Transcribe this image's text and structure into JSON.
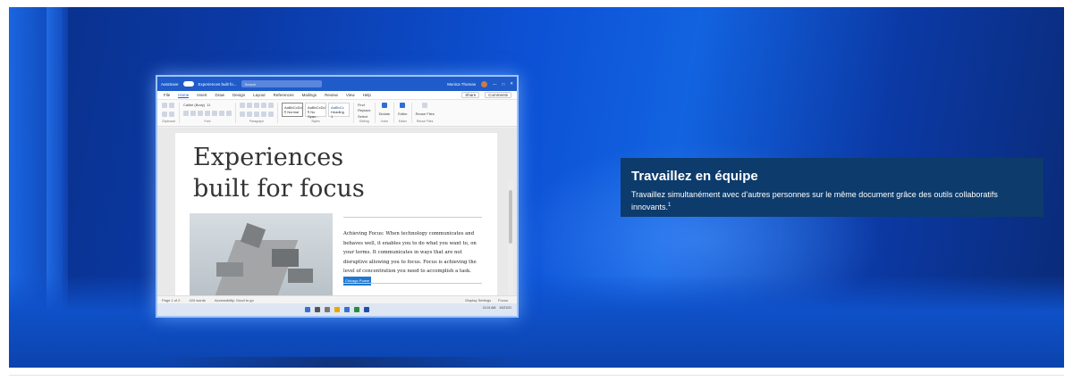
{
  "banner": {
    "colors": {
      "deep_blue": "#0a2f88",
      "bright_blue": "#1263e0",
      "card_bg": "#0d3b6b"
    }
  },
  "word_window": {
    "titlebar": {
      "autosave": "AutoSave",
      "file_name": "Experiences built fo...",
      "search_placeholder": "Search",
      "user_name": "Monica Thomas"
    },
    "menu": [
      "File",
      "Home",
      "Insert",
      "Draw",
      "Design",
      "Layout",
      "References",
      "Mailings",
      "Review",
      "View",
      "Help"
    ],
    "menu_active": "Home",
    "share_label": "Share",
    "comments_label": "Comments",
    "ribbon": {
      "groups": [
        "Clipboard",
        "Font",
        "Paragraph",
        "Styles",
        "Editing",
        "Voice",
        "Editor",
        "Reuse Files"
      ],
      "font_name": "Calibri (Body)",
      "font_size": "11",
      "styles": [
        "AaBbCcDd",
        "AaBbCcDd",
        "AaBbCc"
      ],
      "style_names": [
        "¶ Normal",
        "¶ No Spac...",
        "Heading 1"
      ],
      "editing": [
        "Find",
        "Replace",
        "Select"
      ],
      "voice": "Dictate",
      "editor": "Editor",
      "reuse": "Reuse Files"
    },
    "document": {
      "title_line1": "Experiences",
      "title_line2": "built for focus",
      "paragraph": "Achieving Focus: When technology communicates and behaves well, it enables you to do what you want to, on your terms. It communicates in ways that are not disruptive allowing you to focus. Focus is achieving the level of concentration you need to accomplish a task.",
      "coauthor_tag": "Chicago Pcane"
    },
    "statusbar": {
      "page": "Page 1 of 2",
      "words": "424 words",
      "accessibility": "Accessibility: Good to go",
      "display": "Display Settings",
      "focus": "Focus"
    },
    "taskbar": {
      "time": "11:01 AM",
      "date": "10/21/21"
    }
  },
  "info_card": {
    "title": "Travaillez en équipe",
    "text": "Travaillez simultanément avec d’autres personnes sur le même document grâce des outils collaboratifs innovants.",
    "footnote": "1"
  }
}
